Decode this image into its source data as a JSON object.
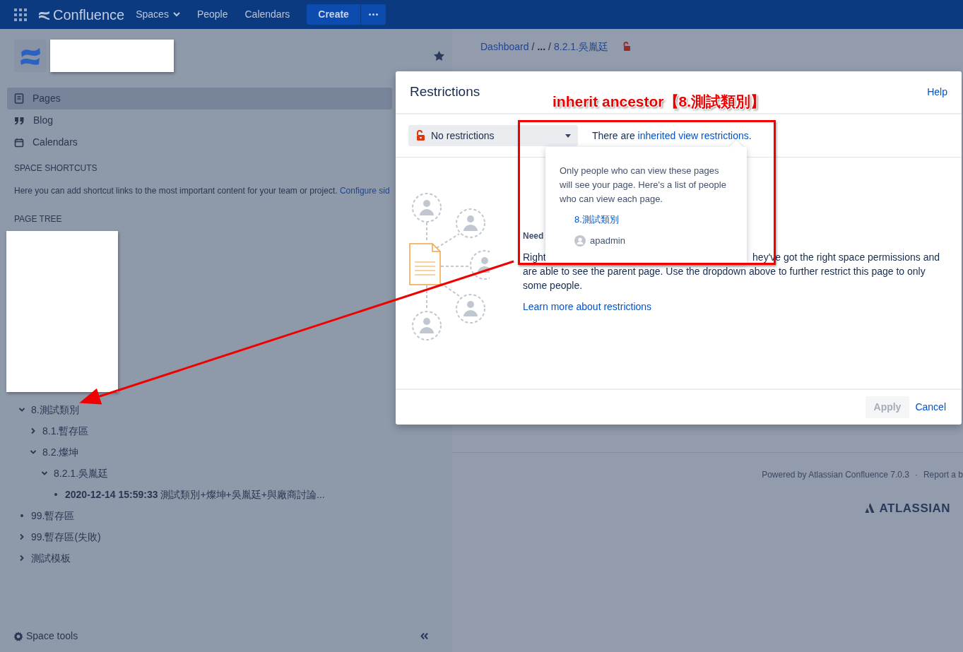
{
  "topnav": {
    "app_name": "Confluence",
    "links": [
      {
        "label": "Spaces",
        "dropdown": true
      },
      {
        "label": "People",
        "dropdown": false
      },
      {
        "label": "Calendars",
        "dropdown": false
      }
    ],
    "create": "Create"
  },
  "sidebar": {
    "nav": [
      {
        "label": "Pages",
        "kind": "page",
        "selected": true
      },
      {
        "label": "Blog",
        "kind": "quote",
        "selected": false
      },
      {
        "label": "Calendars",
        "kind": "calendar",
        "selected": false
      }
    ],
    "shortcuts_heading": "SPACE SHORTCUTS",
    "shortcuts_text": "Here you can add shortcut links to the most important content for your team or project.",
    "shortcuts_link": "Configure sid",
    "tree_heading": "PAGE TREE",
    "tree": [
      {
        "title": "8.測試類別",
        "expanded": true,
        "children": [
          {
            "title": "8.1.暫存區",
            "expanded": false
          },
          {
            "title": "8.2.燦坤",
            "expanded": true,
            "children": [
              {
                "title": "8.2.1.吳胤廷",
                "expanded": true,
                "children": [
                  {
                    "title": "**2020-12-14 15:59:33** 測試類別+燦坤+吳胤廷+與廠商討論..."
                  }
                ]
              }
            ]
          }
        ]
      },
      {
        "title": "99.暫存區"
      },
      {
        "title": "99.暫存區(失敗)",
        "expanded": false
      },
      {
        "title": "測試模板",
        "expanded": false
      }
    ],
    "space_tools": "Space tools"
  },
  "page": {
    "breadcrumbs": [
      {
        "kind": "link",
        "text": "Dashboard"
      },
      {
        "kind": "sep",
        "text": "/"
      },
      {
        "kind": "more",
        "text": "..."
      },
      {
        "kind": "sep",
        "text": "/"
      },
      {
        "kind": "link",
        "text": "8.2.1.吳胤廷"
      }
    ],
    "footer": {
      "powered": "Powered by Atlassian Confluence 7.0.3",
      "separator": "·",
      "report": "Report a b"
    },
    "atlassian_logo": "ATLASSIAN"
  },
  "modal": {
    "title": "Restrictions",
    "help": "Help",
    "dropdown": "No restrictions",
    "inherited_prefix": "There are",
    "inherited_link": "inherited view restrictions",
    "inherited_suffix": ".",
    "body_heading": "Need",
    "body_lines": [
      [
        "Right",
        "hey've got the right space permissions and"
      ],
      [
        "are able to see the parent page. Use the dropdown above to further restrict this page to only"
      ],
      [
        "some people."
      ]
    ],
    "learn_more": "Learn more about restrictions",
    "apply": {
      "label": "Apply",
      "disabled": true
    },
    "cancel": "Cancel",
    "popover": {
      "text": "Only people who can view these pages will see your page. Here's a list of people who can view each page.",
      "pages": [
        {
          "title": "8.測試類別",
          "users": [
            "apadmin"
          ]
        }
      ]
    }
  },
  "annotation": {
    "label": "inherit ancestor【8.測試類別】"
  }
}
